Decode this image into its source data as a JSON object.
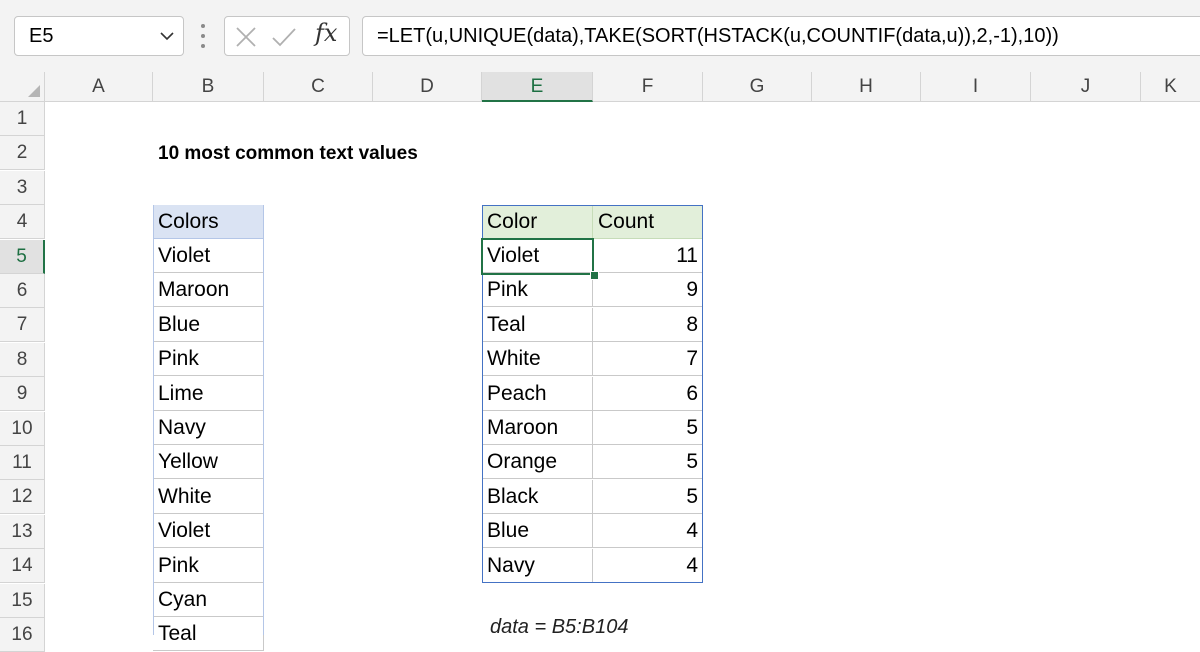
{
  "formula_bar": {
    "name_box": "E5",
    "fx_label": "fx",
    "formula": "=LET(u,UNIQUE(data),TAKE(SORT(HSTACK(u,COUNTIF(data,u)),2,-1),10))"
  },
  "columns": [
    "A",
    "B",
    "C",
    "D",
    "E",
    "F",
    "G",
    "H",
    "I",
    "J",
    "K"
  ],
  "active_column": "E",
  "rows": [
    "1",
    "2",
    "3",
    "4",
    "5",
    "6",
    "7",
    "8",
    "9",
    "10",
    "11",
    "12",
    "13",
    "14",
    "15",
    "16"
  ],
  "active_row": "5",
  "sheet": {
    "title": "10 most common text values",
    "colors_header": "Colors",
    "colors": [
      "Violet",
      "Maroon",
      "Blue",
      "Pink",
      "Lime",
      "Navy",
      "Yellow",
      "White",
      "Violet",
      "Pink",
      "Cyan",
      "Teal"
    ],
    "result_headers": [
      "Color",
      "Count"
    ],
    "results": [
      {
        "color": "Violet",
        "count": "11"
      },
      {
        "color": "Pink",
        "count": "9"
      },
      {
        "color": "Teal",
        "count": "8"
      },
      {
        "color": "White",
        "count": "7"
      },
      {
        "color": "Peach",
        "count": "6"
      },
      {
        "color": "Maroon",
        "count": "5"
      },
      {
        "color": "Orange",
        "count": "5"
      },
      {
        "color": "Black",
        "count": "5"
      },
      {
        "color": "Blue",
        "count": "4"
      },
      {
        "color": "Navy",
        "count": "4"
      }
    ],
    "note": "data = B5:B104"
  },
  "colors_hex": {
    "accent": "#217346",
    "header_blue": "#dae3f3",
    "header_green": "#e2efda",
    "result_border": "#4472c4"
  }
}
